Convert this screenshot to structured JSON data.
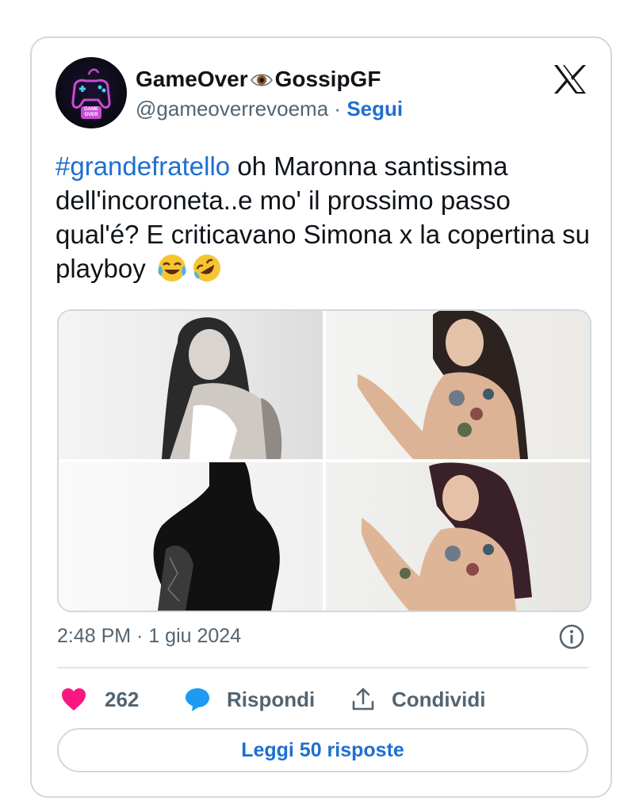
{
  "author": {
    "display_name_part1": "GameOver",
    "display_name_part2": "GossipGF",
    "handle": "@gameoverrevoema",
    "separator": "·",
    "follow_label": "Segui",
    "avatar_text": "GAME OVER"
  },
  "tweet": {
    "hashtag": "#grandefratello",
    "text": " oh Maronna santissima dell'incoroneta..e mo' il prossimo passo qual'é? E criticavano Simona x la copertina su playboy",
    "emojis": [
      "tears-of-joy-emoji",
      "rolling-on-floor-laughing-emoji"
    ],
    "media_count": 4
  },
  "meta": {
    "timestamp": "2:48 PM · 1 giu 2024"
  },
  "actions": {
    "likes": "262",
    "reply_label": "Rispondi",
    "share_label": "Condividi"
  },
  "footer": {
    "read_replies_label": "Leggi 50 risposte"
  },
  "icons": [
    "x-logo-icon",
    "eye-icon",
    "info-icon",
    "heart-icon",
    "reply-bubble-icon",
    "share-icon"
  ],
  "colors": {
    "link_blue": "#1d6fd0",
    "like_pink": "#f91880",
    "reply_blue": "#1d9bf0",
    "muted": "#536471",
    "border": "#cfd9de"
  }
}
